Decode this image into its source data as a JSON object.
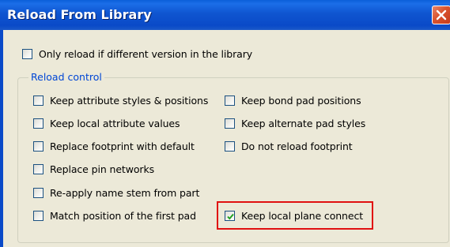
{
  "window": {
    "title": "Reload From Library"
  },
  "top_option": {
    "label": "Only reload if different version in the library",
    "checked": false
  },
  "group": {
    "legend": "Reload control",
    "left_options": [
      {
        "label": "Keep attribute styles & positions",
        "checked": false
      },
      {
        "label": "Keep local attribute values",
        "checked": false
      },
      {
        "label": "Replace footprint with default",
        "checked": false
      },
      {
        "label": "Replace pin networks",
        "checked": false
      },
      {
        "label": "Re-apply name stem from part",
        "checked": false
      },
      {
        "label": "Match position of the first pad",
        "checked": false
      }
    ],
    "right_options": [
      {
        "label": "Keep bond pad positions",
        "checked": false
      },
      {
        "label": "Keep alternate pad styles",
        "checked": false
      },
      {
        "label": "Do not reload footprint",
        "checked": false
      },
      {
        "label": "Keep local plane connect",
        "checked": true
      }
    ]
  },
  "colors": {
    "highlight": "#e01010",
    "check": "#21a121",
    "legend": "#0046d5"
  }
}
